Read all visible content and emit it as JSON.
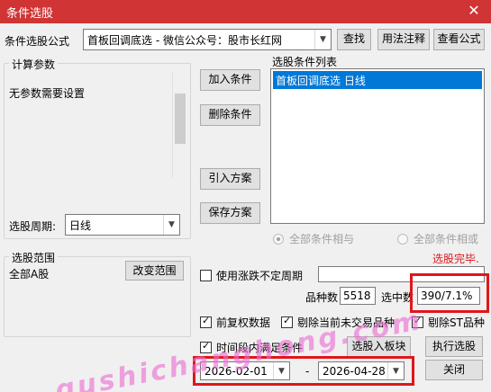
{
  "window": {
    "title": "条件选股",
    "close_glyph": "✕"
  },
  "formula": {
    "label": "条件选股公式",
    "value": "首板回调底选  -  微信公众号：股市长红网",
    "find_btn": "查找",
    "usage_btn": "用法注释",
    "view_btn": "查看公式"
  },
  "params": {
    "group_title": "计算参数",
    "no_param_text": "无参数需要设置",
    "period_label": "选股周期:",
    "period_value": "日线"
  },
  "actions": {
    "add": "加入条件",
    "delete": "删除条件",
    "import_plan": "引入方案",
    "save_plan": "保存方案"
  },
  "conditions": {
    "group_title": "选股条件列表",
    "items": [
      "首板回调底选  日线"
    ],
    "logic_and": "全部条件相与",
    "logic_or": "全部条件相或"
  },
  "status": {
    "text": "选股完毕.",
    "color": "#e0161b"
  },
  "range": {
    "group_title": "选股范围",
    "value": "全部A股",
    "change_btn": "改变范围"
  },
  "options": {
    "uncertain_period": "使用涨跌不定周期",
    "count_label": "品种数",
    "count_value": "5518",
    "selected_label": "选中数",
    "selected_value": "390/7.1%",
    "prior_rights": "前复权数据",
    "exclude_untraded": "剔除当前未交易品种",
    "exclude_st": "剔除ST品种",
    "time_range": "时间段内满足条件"
  },
  "bottom": {
    "to_block_btn": "选股入板块",
    "execute_btn": "执行选股",
    "start_date": "2026-02-01",
    "dash": "-",
    "end_date": "2026-04-28",
    "close_btn": "关闭"
  },
  "watermark": "gushichanghong.com"
}
